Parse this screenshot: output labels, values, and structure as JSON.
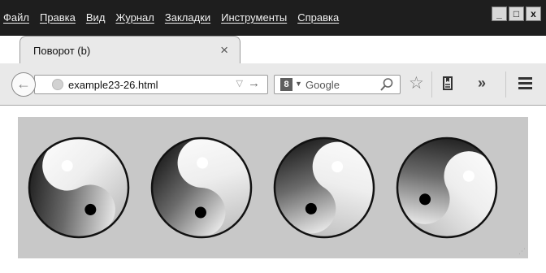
{
  "menubar": {
    "items": [
      "Файл",
      "Правка",
      "Вид",
      "Журнал",
      "Закладки",
      "Инструменты",
      "Справка"
    ]
  },
  "window_controls": {
    "minimize": "_",
    "maximize": "□",
    "close": "x"
  },
  "tab": {
    "title": "Поворот (b)",
    "close_icon": "close-icon"
  },
  "newtab_icon": "+",
  "navbar": {
    "address": "example23-26.html",
    "search_placeholder": "Google",
    "search_engine_icon": "8",
    "more_label": "»"
  },
  "page": {
    "background": "#c8c8c8",
    "figures": [
      {
        "label": "yin-yang",
        "rotation_deg": 0
      },
      {
        "label": "yin-yang",
        "rotation_deg": 30
      },
      {
        "label": "yin-yang",
        "rotation_deg": 60
      },
      {
        "label": "yin-yang",
        "rotation_deg": 90
      }
    ]
  }
}
